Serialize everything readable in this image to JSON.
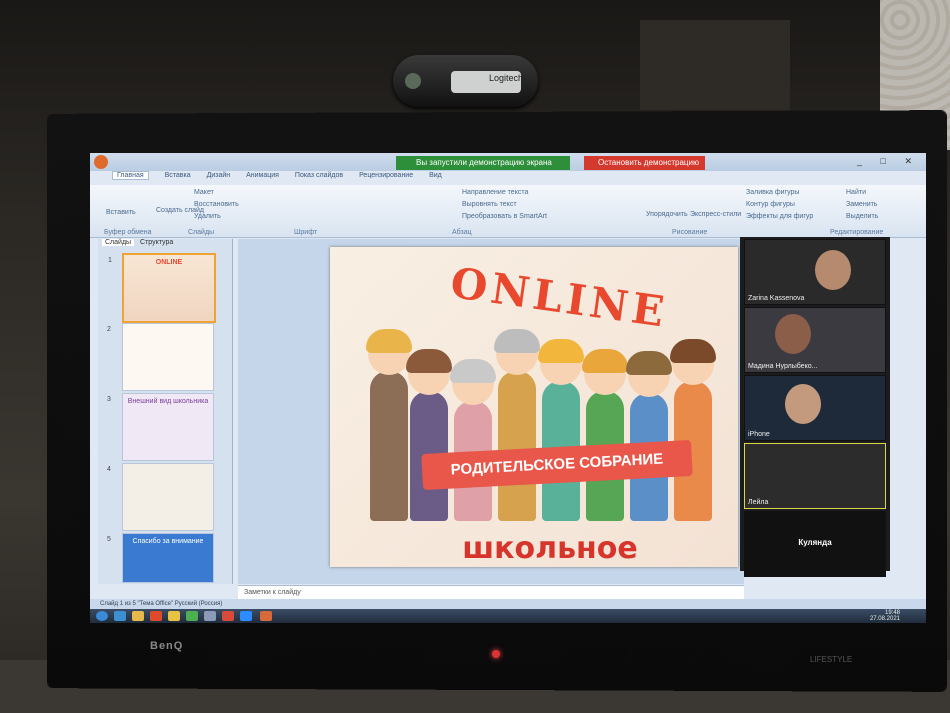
{
  "webcam": {
    "brand": "Logitech"
  },
  "monitor": {
    "brand": "BenQ",
    "model": "LIFESTYLE"
  },
  "window": {
    "tabs": [
      "Главная",
      "Вставка",
      "Дизайн",
      "Анимация",
      "Показ слайдов",
      "Рецензирование",
      "Вид"
    ],
    "controls": "_ □ ✕"
  },
  "zoom": {
    "sharing_notice": "Вы запустили демонстрацию экрана",
    "stop_button": "Остановить демонстрацию",
    "participants": [
      {
        "name": "Zarina Kassenova"
      },
      {
        "name": "Мадина Нурлыбеко..."
      },
      {
        "name": "iPhone"
      },
      {
        "name": "Лейла"
      },
      {
        "name": "Кулянда"
      }
    ]
  },
  "ribbon": {
    "paste": "Вставить",
    "new_slide": "Создать слайд",
    "layout": "Макет",
    "reset": "Восстановить",
    "delete": "Удалить",
    "arrange": "Упорядочить",
    "quick_styles": "Экспресс-стили",
    "fill": "Заливка фигуры",
    "outline": "Контур фигуры",
    "effects": "Эффекты для фигур",
    "find": "Найти",
    "replace": "Заменить",
    "select": "Выделить",
    "text_direction": "Направление текста",
    "align_text": "Выровнять текст",
    "smartart": "Преобразовать в SmartArt",
    "groups": {
      "clipboard": "Буфер обмена",
      "slides": "Слайды",
      "font": "Шрифт",
      "paragraph": "Абзац",
      "drawing": "Рисование",
      "editing": "Редактирование"
    }
  },
  "slides_pane": {
    "tabs": [
      "Слайды",
      "Структура"
    ],
    "thumbnails": [
      {
        "num": "1",
        "title": "ONLINE"
      },
      {
        "num": "2",
        "title": ""
      },
      {
        "num": "3",
        "title": "Внешний вид школьника"
      },
      {
        "num": "4",
        "title": ""
      },
      {
        "num": "5",
        "title": "Спасибо за внимание"
      }
    ]
  },
  "slide": {
    "title": "ONLINE",
    "banner": "РОДИТЕЛЬСКОЕ СОБРАНИЕ",
    "subtitle": "школьное"
  },
  "notes": {
    "placeholder": "Заметки к слайду"
  },
  "statusbar": {
    "text": "Слайд 1 из 5    \"Тема Office\"    Русский (Россия)"
  },
  "taskbar": {
    "time": "19:48",
    "date": "27.08.2021"
  },
  "colors": {
    "zoom_green": "#2d8f3a",
    "zoom_red": "#d5382c",
    "slide_red": "#e8492e"
  }
}
